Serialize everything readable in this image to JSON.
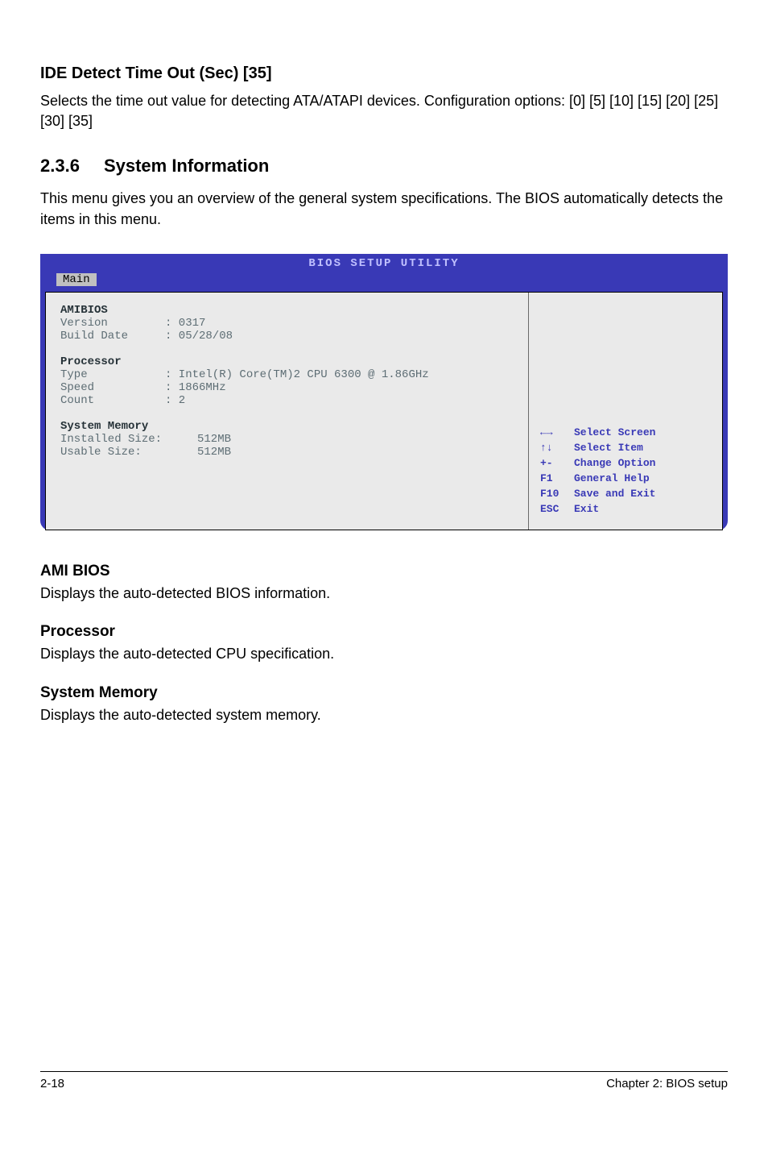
{
  "ide_heading": "IDE Detect Time Out (Sec) [35]",
  "ide_body": "Selects the time out value for detecting ATA/ATAPI devices. Configuration options: [0] [5] [10] [15] [20] [25] [30] [35]",
  "section_num": "2.3.6",
  "section_title": "System Information",
  "section_body": "This menu gives you an overview of the general system specifications. The BIOS automatically detects the items in this menu.",
  "bios": {
    "title": "BIOS SETUP UTILITY",
    "tab": "Main",
    "amibios_heading": "AMIBIOS",
    "amibios_version_label": "Version",
    "amibios_version_value": ": 0317",
    "amibios_date_label": "Build Date",
    "amibios_date_value": ": 05/28/08",
    "proc_heading": "Processor",
    "proc_type_label": "Type",
    "proc_type_value": ": Intel(R) Core(TM)2 CPU 6300 @ 1.86GHz",
    "proc_speed_label": "Speed",
    "proc_speed_value": ": 1866MHz",
    "proc_count_label": "Count",
    "proc_count_value": ": 2",
    "mem_heading": "System Memory",
    "mem_installed_label": "Installed Size:",
    "mem_installed_value": "512MB",
    "mem_usable_label": "Usable Size:",
    "mem_usable_value": "512MB",
    "legend": {
      "lr": "←→",
      "lr_text": "Select Screen",
      "ud": "↑↓",
      "ud_text": "Select Item",
      "pm": "+-",
      "pm_text": "Change Option",
      "f1": "F1",
      "f1_text": "General Help",
      "f10": "F10",
      "f10_text": "Save and Exit",
      "esc": "ESC",
      "esc_text": "Exit"
    }
  },
  "ami_heading": "AMI BIOS",
  "ami_body": "Displays the auto-detected BIOS information.",
  "proc_sub_heading": "Processor",
  "proc_sub_body": "Displays the auto-detected CPU specification.",
  "mem_sub_heading": "System Memory",
  "mem_sub_body": "Displays the auto-detected system memory.",
  "footer_left": "2-18",
  "footer_right": "Chapter 2: BIOS setup"
}
